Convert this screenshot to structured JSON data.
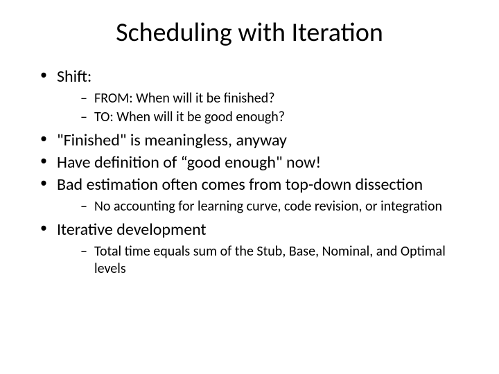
{
  "title": "Scheduling with Iteration",
  "b1": "Shift:",
  "b1s1": "FROM: When will it be finished?",
  "b1s2": "TO: When will it be good enough?",
  "b2": "\"Finished\" is meaningless, anyway",
  "b3": "Have definition of “good enough\" now!",
  "b4": "Bad estimation often comes from top-down dissection",
  "b4s1": "No accounting for learning curve, code revision, or integration",
  "b5": "Iterative development",
  "b5s1": "Total time equals sum of the Stub, Base, Nominal, and Optimal levels"
}
